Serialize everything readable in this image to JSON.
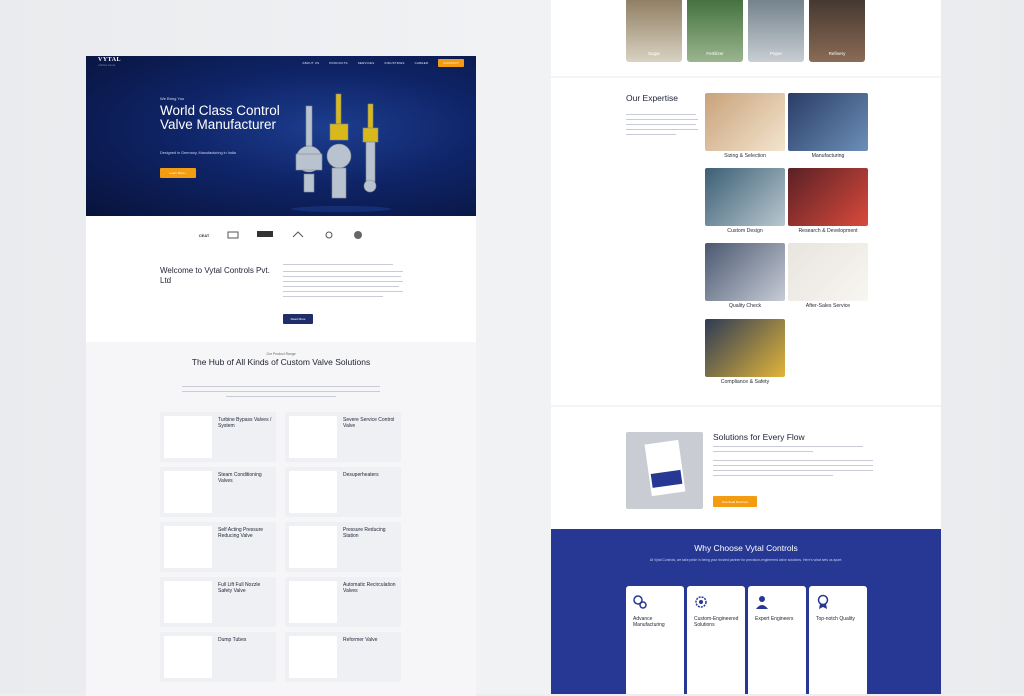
{
  "left": {
    "nav": {
      "logo": "VYTAL",
      "logo_tagline": "CONTROL VALVES",
      "items": [
        "ABOUT US",
        "PRODUCTS",
        "SERVICES",
        "INDUSTRIES",
        "CAREER"
      ],
      "cta": "CONTACT"
    },
    "hero": {
      "eyebrow": "We Bring You",
      "title": "World Class Control Valve Manufacturer",
      "subtitle": "Designed in Germany, Manufacturing in India",
      "button": "Learn More"
    },
    "clients": [
      "CEAT",
      "",
      "",
      "",
      "",
      ""
    ],
    "welcome": {
      "title": "Welcome to Vytal Controls Pvt. Ltd",
      "button": "Read More"
    },
    "hub": {
      "eyebrow": "Our Product Range",
      "title": "The Hub of All Kinds of Custom Valve Solutions",
      "products": [
        "Turbine Bypass Valves / System",
        "Severe Service Control Valve",
        "Steam Conditioning Valves",
        "Desuperheaters",
        "Self Acting Pressure Reducing Valve",
        "Pressure Reducing Station",
        "Full Lift Full Nozzle Safety Valve",
        "Automatic Recirculation Valves",
        "Dump Tubes",
        "Reformer Valve"
      ]
    }
  },
  "right": {
    "applications": [
      "Sugar",
      "Fertilizer",
      "Paper",
      "Refinery"
    ],
    "expertise": {
      "title": "Our Expertise",
      "items": [
        "Sizing & Selection",
        "Manufacturing",
        "Custom Design",
        "Research & Development",
        "Quality Check",
        "After-Sales Service",
        "Compliance & Safety"
      ]
    },
    "solutions": {
      "title": "Solutions for Every Flow",
      "button": "Download Brochure"
    },
    "why": {
      "title": "Why Choose Vytal Controls",
      "subtitle": "At Vytal Controls, we take pride in being your trusted partner for precision-engineered valve solutions. Here's what sets us apart:",
      "features": [
        "Advance Manufacturing",
        "Custom-Engineered Solutions",
        "Expert Engineers",
        "Top-notch Quality"
      ]
    }
  },
  "colors": {
    "brand_navy": "#263893",
    "accent_orange": "#f39c12",
    "hero_dark": "#0f2467"
  }
}
